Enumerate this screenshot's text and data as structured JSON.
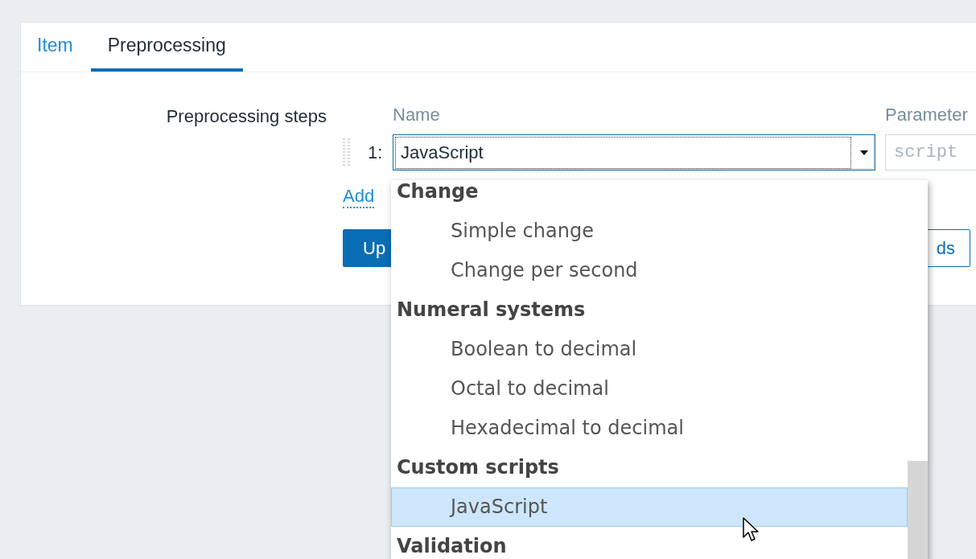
{
  "tabs": [
    {
      "label": "Item",
      "selected": false
    },
    {
      "label": "Preprocessing",
      "selected": true
    }
  ],
  "form": {
    "label": "Preprocessing steps",
    "columns": [
      "Name",
      "Parameter"
    ],
    "steps": [
      {
        "number": "1:",
        "name": "JavaScript",
        "parameter_placeholder": "script"
      }
    ],
    "add_link": "Add",
    "buttons": [
      {
        "label": "Up",
        "kind": "primary"
      },
      {
        "label": "ds",
        "kind": "secondary"
      }
    ]
  },
  "dropdown": {
    "items": [
      {
        "kind": "group",
        "label": "Change"
      },
      {
        "kind": "option",
        "label": "Simple change",
        "selected": false
      },
      {
        "kind": "option",
        "label": "Change per second",
        "selected": false
      },
      {
        "kind": "group",
        "label": "Numeral systems"
      },
      {
        "kind": "option",
        "label": "Boolean to decimal",
        "selected": false
      },
      {
        "kind": "option",
        "label": "Octal to decimal",
        "selected": false
      },
      {
        "kind": "option",
        "label": "Hexadecimal to decimal",
        "selected": false
      },
      {
        "kind": "group",
        "label": "Custom scripts"
      },
      {
        "kind": "option",
        "label": "JavaScript",
        "selected": true
      },
      {
        "kind": "group",
        "label": "Validation"
      }
    ]
  }
}
